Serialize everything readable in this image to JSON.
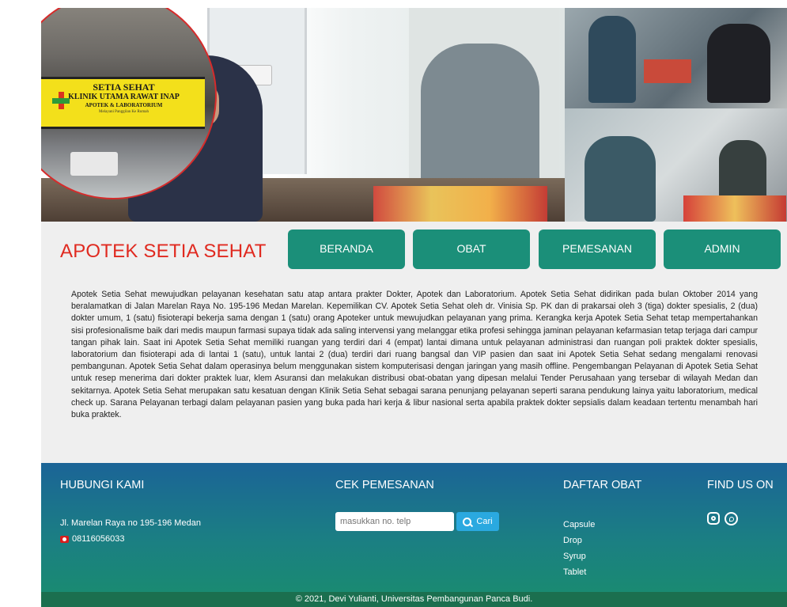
{
  "hero": {
    "sign": {
      "line1": "SETIA SEHAT",
      "line2": "KLINIK UTAMA RAWAT INAP",
      "line3": "APOTEK & LABORATORIUM",
      "line4": "Melayani Panggilan Ke Rumah"
    }
  },
  "header": {
    "brand": "APOTEK SETIA SEHAT",
    "nav": [
      "BERANDA",
      "OBAT",
      "PEMESANAN",
      "ADMIN"
    ]
  },
  "about": {
    "text": "Apotek Setia Sehat mewujudkan pelayanan kesehatan satu atap antara prakter Dokter, Apotek dan Laboratorium. Apotek Setia Sehat didirikan pada bulan Oktober 2014 yang beralamatkan di Jalan Marelan Raya No. 195-196 Medan Marelan. Kepemilikan CV. Apotek Setia Sehat oleh dr. Vinisia Sp. PK dan di prakarsai oleh 3 (tiga) dokter spesialis, 2 (dua) dokter umum, 1 (satu) fisioterapi bekerja sama dengan 1 (satu) orang Apoteker untuk mewujudkan pelayanan yang prima. Kerangka kerja Apotek Setia Sehat tetap mempertahankan sisi profesionalisme baik dari medis maupun farmasi supaya tidak ada saling intervensi yang melanggar etika profesi sehingga jaminan pelayanan kefarmasian tetap terjaga dari campur tangan pihak lain. Saat ini Apotek Setia Sehat memiliki ruangan yang terdiri dari 4 (empat) lantai dimana untuk pelayanan administrasi dan ruangan poli praktek dokter spesialis, laboratorium dan fisioterapi ada di lantai 1 (satu), untuk lantai 2 (dua) terdiri dari ruang bangsal dan VIP pasien dan saat ini Apotek Setia Sehat sedang mengalami renovasi pembangunan. Apotek Setia Sehat dalam operasinya belum menggunakan sistem komputerisasi dengan jaringan yang masih offline. Pengembangan Pelayanan di Apotek Setia Sehat untuk resep menerima dari dokter praktek luar, klem Asuransi dan melakukan distribusi obat-obatan yang dipesan melalui Tender Perusahaan yang tersebar di wilayah Medan dan sekitarnya. Apotek Setia Sehat merupakan satu kesatuan dengan Klinik Setia Sehat sebagai sarana penunjang pelayanan seperti sarana pendukung lainya yaitu laboratorium, medical check up. Sarana Pelayanan terbagi dalam pelayanan pasien yang buka pada hari kerja & libur nasional serta apabila praktek dokter sepsialis dalam keadaan tertentu menambah hari buka praktek."
  },
  "footer": {
    "contact": {
      "title": "HUBUNGI KAMI",
      "address": "Jl. Marelan Raya no 195-196 Medan",
      "phone": "08116056033"
    },
    "order_check": {
      "title": "CEK PEMESANAN",
      "placeholder": "masukkan no. telp",
      "button": "Cari"
    },
    "medicine": {
      "title": "DAFTAR OBAT",
      "items": [
        "Capsule",
        "Drop",
        "Syrup",
        "Tablet"
      ]
    },
    "social": {
      "title": "FIND US ON",
      "icons": [
        "instagram-icon",
        "whatsapp-icon"
      ]
    },
    "copyright": "© 2021, Devi Yulianti, Universitas Pembangunan Panca Budi."
  },
  "colors": {
    "brand_red": "#e02a20",
    "nav_green": "#1b8f79",
    "footer_blue": "#1b6497",
    "button_blue": "#2aa9e0"
  }
}
